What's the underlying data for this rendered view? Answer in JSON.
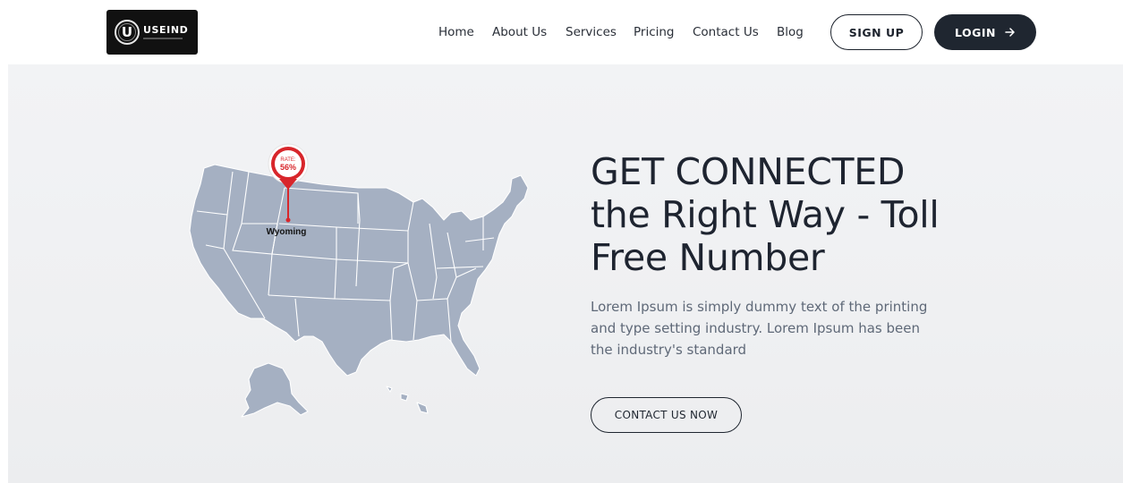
{
  "brand": {
    "name": "USEIND",
    "letter": "U"
  },
  "nav": {
    "items": [
      "Home",
      "About Us",
      "Services",
      "Pricing",
      "Contact Us",
      "Blog"
    ]
  },
  "auth": {
    "signup": "SIGN UP",
    "login": "LOGIN",
    "login_icon": "arrow-right-icon"
  },
  "hero": {
    "headline": [
      "GET CONNECTED",
      "the Right Way - Toll",
      "Free Number"
    ],
    "lead": [
      "Lorem Ipsum is simply dummy text of the printing",
      "and type setting industry. Lorem Ipsum has been",
      "the industry's standard"
    ],
    "cta": "CONTACT US NOW"
  },
  "map": {
    "pin_label": "RATE:",
    "pin_value": "56%",
    "state": "Wyoming",
    "colors": {
      "land": "#a5b0c2",
      "border": "#ffffff",
      "pin": "#d8262b"
    }
  }
}
